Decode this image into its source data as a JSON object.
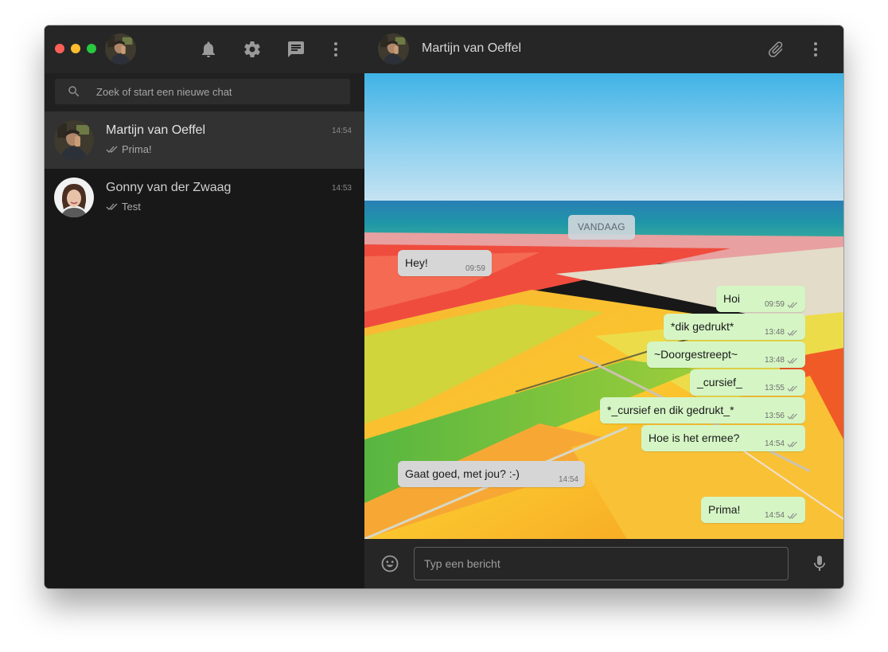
{
  "colors": {
    "sidebar_bg": "#181818",
    "header_bg": "#262626",
    "active_chat_bg": "#323232",
    "incoming_bubble": "#d6d6d6",
    "outgoing_bubble": "#d5f5c5",
    "icon_color": "#9a9a9a"
  },
  "sidebar": {
    "window_controls": [
      "close",
      "minimize",
      "maximize"
    ],
    "header_icons": [
      "bell-icon",
      "gear-icon",
      "new-chat-icon",
      "menu-icon"
    ],
    "search": {
      "placeholder": "Zoek of start een nieuwe chat",
      "value": ""
    },
    "chats": [
      {
        "name": "Martijn van Oeffel",
        "time": "14:54",
        "preview": "Prima!",
        "status": "double-check",
        "active": true
      },
      {
        "name": "Gonny van der Zwaag",
        "time": "14:53",
        "preview": "Test",
        "status": "double-check",
        "active": false
      }
    ]
  },
  "conversation": {
    "contact_name": "Martijn van Oeffel",
    "header_icons": [
      "paperclip-icon",
      "menu-icon"
    ],
    "day_label": "VANDAAG",
    "messages": [
      {
        "direction": "in",
        "text": "Hey!",
        "time": "09:59"
      },
      {
        "direction": "out",
        "text": "Hoi",
        "time": "09:59",
        "status": "double-check"
      },
      {
        "direction": "out",
        "text": "*dik gedrukt*",
        "time": "13:48",
        "status": "double-check"
      },
      {
        "direction": "out",
        "text": "~Doorgestreept~",
        "time": "13:48",
        "status": "double-check"
      },
      {
        "direction": "out",
        "text": "_cursief_",
        "time": "13:55",
        "status": "double-check"
      },
      {
        "direction": "out",
        "text": "*_cursief en dik gedrukt_*",
        "time": "13:56",
        "status": "double-check"
      },
      {
        "direction": "out",
        "text": "Hoe is het ermee?",
        "time": "14:54",
        "status": "double-check"
      },
      {
        "direction": "in",
        "text": "Gaat goed, met jou? :-)",
        "time": "14:54"
      },
      {
        "direction": "out",
        "text": "Prima!",
        "time": "14:54",
        "status": "double-check"
      }
    ],
    "composer": {
      "placeholder": "Typ een bericht",
      "value": ""
    }
  }
}
